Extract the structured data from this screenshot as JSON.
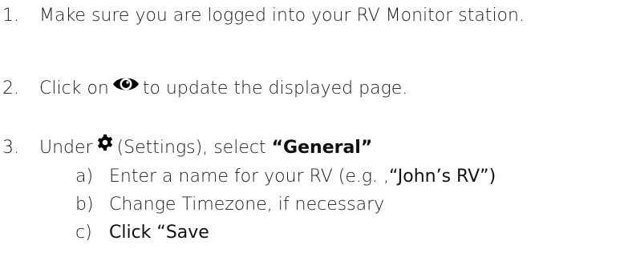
{
  "steps": [
    {
      "number": "1.",
      "text": "Make sure you are logged into your RV Monitor station."
    },
    {
      "number": "2.",
      "text_before": "Click on",
      "icon": "eye-icon",
      "text_after": "to update the displayed page."
    },
    {
      "number": "3.",
      "text_before": "Under",
      "icon": "gear-icon",
      "text_middle": "(Settings), select",
      "emphasis": "“General”",
      "substeps": [
        {
          "letter": "a)",
          "text_before": "Enter a name for your RV (e.g. , ",
          "quote": "“John’s RV”)"
        },
        {
          "letter": "b)",
          "text": "Change Timezone, if necessary"
        },
        {
          "letter": "c)",
          "text": "Click “Save"
        }
      ]
    }
  ],
  "colors": {
    "text": "#1c1c1c",
    "icon": "#000000"
  }
}
